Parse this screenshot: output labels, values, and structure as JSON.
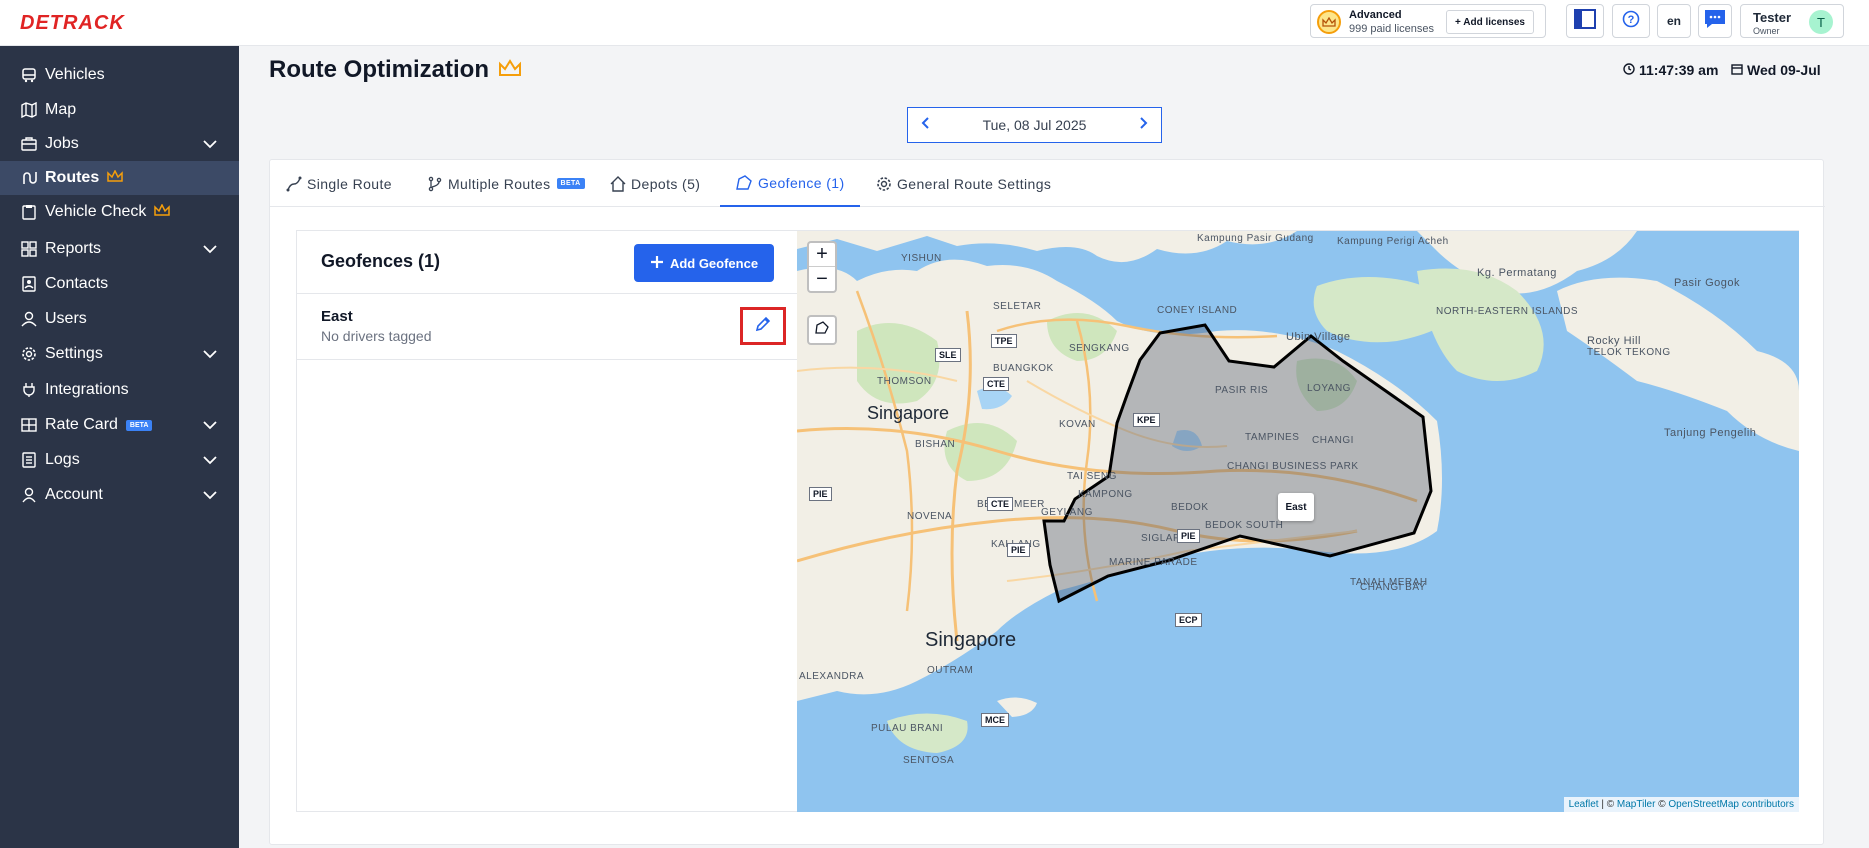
{
  "header": {
    "logo": "DETRACK",
    "license": {
      "title": "Advanced",
      "subtitle": "999 paid licenses",
      "add_label": "+ Add licenses"
    },
    "language": "en",
    "user": {
      "name": "Tester",
      "role": "Owner",
      "initial": "T"
    }
  },
  "sidebar": {
    "items": [
      {
        "label": "Vehicles",
        "icon": "vehicle-icon"
      },
      {
        "label": "Map",
        "icon": "map-icon"
      },
      {
        "label": "Jobs",
        "icon": "briefcase-icon",
        "expandable": true
      },
      {
        "label": "Routes",
        "icon": "route-icon",
        "active": true,
        "premium": true
      },
      {
        "label": "Vehicle Check",
        "icon": "clipboard-icon",
        "premium": true
      },
      {
        "label": "Reports",
        "icon": "grid-icon",
        "expandable": true
      },
      {
        "label": "Contacts",
        "icon": "contacts-icon"
      },
      {
        "label": "Users",
        "icon": "user-icon"
      },
      {
        "label": "Settings",
        "icon": "gear-icon",
        "expandable": true
      },
      {
        "label": "Integrations",
        "icon": "plug-icon"
      },
      {
        "label": "Rate Card",
        "icon": "rate-card-icon",
        "badge": "BETA",
        "expandable": true
      },
      {
        "label": "Logs",
        "icon": "logs-icon",
        "expandable": true
      },
      {
        "label": "Account",
        "icon": "account-icon",
        "expandable": true
      }
    ]
  },
  "page": {
    "title": "Route Optimization",
    "time": "11:47:39 am",
    "date": "Wed 09-Jul",
    "selected_date": "Tue, 08 Jul 2025"
  },
  "tabs": [
    {
      "label": "Single Route"
    },
    {
      "label": "Multiple Routes",
      "badge": "BETA"
    },
    {
      "label": "Depots (5)"
    },
    {
      "label": "Geofence (1)",
      "active": true
    },
    {
      "label": "General Route Settings"
    }
  ],
  "geofence_panel": {
    "title": "Geofences (1)",
    "add_label": "Add Geofence",
    "items": [
      {
        "name": "East",
        "subtitle": "No drivers tagged"
      }
    ]
  },
  "map": {
    "zoom_in": "+",
    "zoom_out": "−",
    "polygon_label": "East",
    "attribution": {
      "leaflet": "Leaflet",
      "sep": " | © ",
      "maptiler": "MapTiler",
      "osm_pre": " © ",
      "osm": "OpenStreetMap contributors"
    },
    "cities": [
      "Singapore",
      "Singapore"
    ],
    "places": [
      "YISHUN",
      "SELETAR",
      "SENGKANG",
      "BUANGKOK",
      "THOMSON",
      "KOVAN",
      "BISHAN",
      "TAMPINES",
      "PASIR RIS",
      "LOYANG",
      "CHANGI",
      "TAI SENG",
      "KAMPONG",
      "BEDOK",
      "BEDOK SOUTH",
      "SIGLAP",
      "MARINE PARADE",
      "GEYLANG",
      "KALLANG",
      "NOVENA",
      "BENDEMEER",
      "OUTRAM",
      "ALEXANDRA",
      "PULAU BRANI",
      "SENTOSA",
      "TANAH MERAH",
      "CHANGI BAY",
      "Ubin Village",
      "Kg. Permatang",
      "Pasir Gogok",
      "NORTH-EASTERN ISLANDS",
      "Rocky Hill",
      "TELOK TEKONG",
      "Tanjung Pengelih",
      "CHANGI BUSINESS PARK",
      "CONEY ISLAND",
      "Kampung Pasir Gudang",
      "Kampung Perigi Acheh"
    ],
    "roads": [
      "TPE",
      "SLE",
      "CTE",
      "KPE",
      "PIE",
      "CTE",
      "PIE",
      "PIE",
      "ECP",
      "MCE"
    ]
  }
}
